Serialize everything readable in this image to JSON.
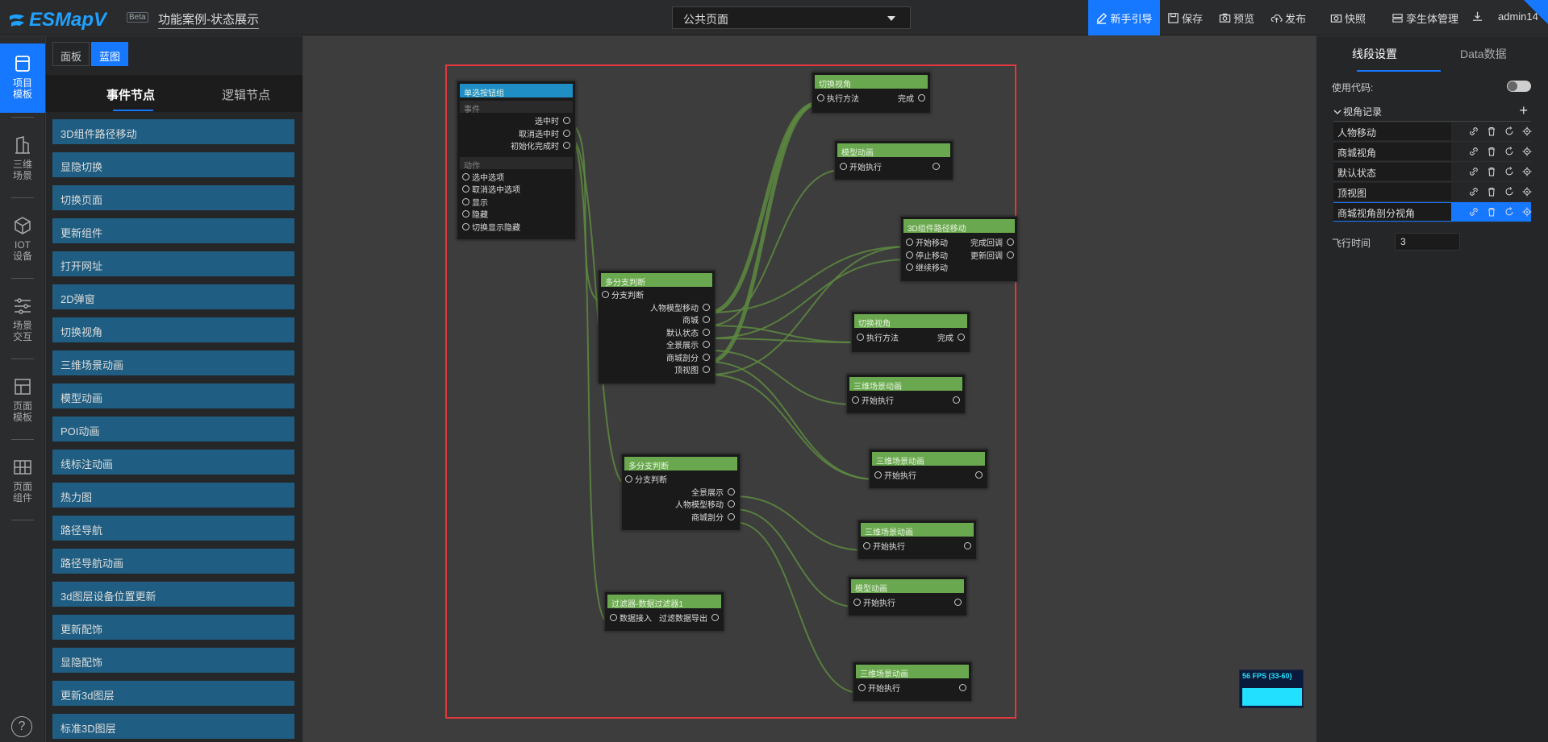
{
  "app": {
    "logo_text": "ESMapV",
    "beta_label": "Beta",
    "page_title": "功能案例-状态展示",
    "page_selector_value": "公共页面"
  },
  "toolbar": {
    "guide": "新手引导",
    "save": "保存",
    "preview": "预览",
    "publish": "发布",
    "snapshot": "快照",
    "twin": "孪生体管理",
    "user": "admin14"
  },
  "leftnav": {
    "items": [
      {
        "label1": "项目",
        "label2": "模板",
        "icon": "project-template-icon"
      },
      {
        "label1": "三维",
        "label2": "场景",
        "icon": "building-icon"
      },
      {
        "label1": "IOT",
        "label2": "设备",
        "icon": "cube-icon"
      },
      {
        "label1": "场景",
        "label2": "交互",
        "icon": "sliders-icon"
      },
      {
        "label1": "页面",
        "label2": "模板",
        "icon": "page-template-icon"
      },
      {
        "label1": "页面",
        "label2": "组件",
        "icon": "grid-icon"
      }
    ],
    "help": "?"
  },
  "panel": {
    "tab_board": "面板",
    "tab_blueprint": "蓝图",
    "subtab_event": "事件节点",
    "subtab_logic": "逻辑节点",
    "nodes": [
      "3D组件路径移动",
      "显隐切换",
      "切换页面",
      "更新组件",
      "打开网址",
      "2D弹窗",
      "切换视角",
      "三维场景动画",
      "模型动画",
      "POI动画",
      "线标注动画",
      "热力图",
      "路径导航",
      "路径导航动画",
      "3d图层设备位置更新",
      "更新配饰",
      "显隐配饰",
      "更新3d图层",
      "标准3D图层"
    ]
  },
  "graph": {
    "radio": {
      "title": "单选按钮组",
      "sec_event": "事件",
      "outputs": [
        "选中时",
        "取消选中时",
        "初始化完成时"
      ],
      "sec_action": "动作",
      "inputs": [
        "选中选项",
        "取消选中选项",
        "显示",
        "隐藏",
        "切换显示隐藏"
      ]
    },
    "switch1": {
      "title": "多分支判断",
      "in": "分支判断",
      "outs": [
        "人物模型移动",
        "商城",
        "默认状态",
        "全景展示",
        "商城剖分",
        "顶视图"
      ]
    },
    "switch2": {
      "title": "多分支判断",
      "in": "分支判断",
      "outs": [
        "全景展示",
        "人物模型移动",
        "商城剖分"
      ]
    },
    "filter": {
      "title": "过滤器-数据过滤器1",
      "in": "数据接入",
      "out": "过滤数据导出"
    },
    "view1": {
      "title": "切换视角",
      "in": "执行方法",
      "out": "完成"
    },
    "model1": {
      "title": "模型动画",
      "in": "开始执行"
    },
    "path3d": {
      "title": "3D组件路径移动",
      "ins": [
        "开始移动",
        "停止移动",
        "继续移动"
      ],
      "outs": [
        "完成回调",
        "更新回调"
      ]
    },
    "view2": {
      "title": "切换视角",
      "in": "执行方法",
      "out": "完成"
    },
    "scene1": {
      "title": "三维场景动画",
      "in": "开始执行"
    },
    "scene2": {
      "title": "三维场景动画",
      "in": "开始执行"
    },
    "scene3": {
      "title": "三维场景动画",
      "in": "开始执行"
    },
    "model2": {
      "title": "模型动画",
      "in": "开始执行"
    },
    "scene4": {
      "title": "三维场景动画",
      "in": "开始执行"
    }
  },
  "fps": {
    "text": "56 FPS (33-60)"
  },
  "rpanel": {
    "tab_segment": "线段设置",
    "tab_data": "Data数据",
    "use_code": "使用代码:",
    "use_code_on": false,
    "view_record": "视角记录",
    "views": [
      "人物移动",
      "商城视角",
      "默认状态",
      "顶视图",
      "商城视角剖分视角"
    ],
    "fly_time_label": "飞行时间",
    "fly_time_value": "3"
  },
  "colors": {
    "accent": "#1677ff",
    "wire": "#5d8a3f",
    "node_header": "#6aa84f",
    "frame": "#e0383c"
  }
}
